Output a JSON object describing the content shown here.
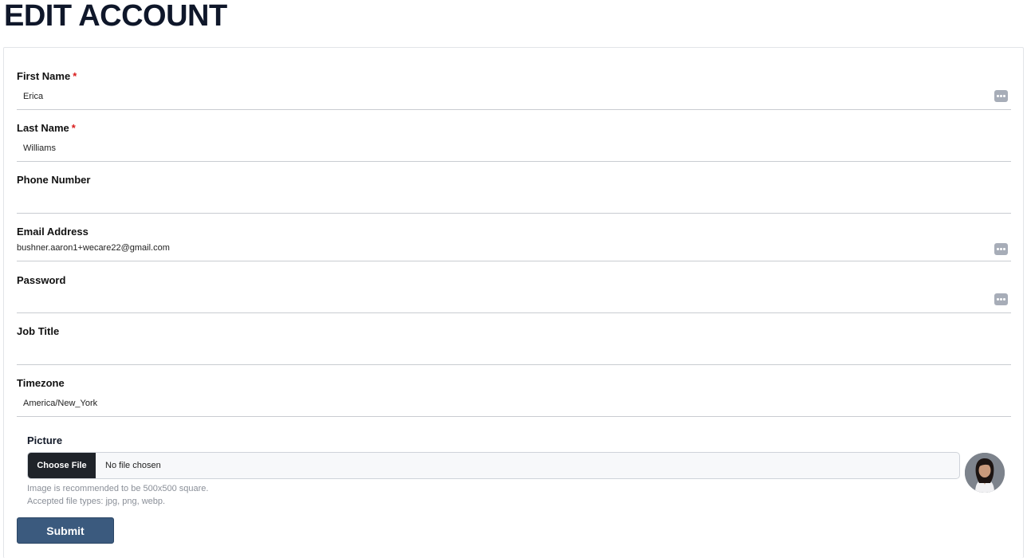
{
  "page": {
    "title": "EDIT ACCOUNT"
  },
  "form": {
    "first_name": {
      "label": "First Name",
      "required": "*",
      "value": "Erica"
    },
    "last_name": {
      "label": "Last Name",
      "required": "*",
      "value": "Williams"
    },
    "phone": {
      "label": "Phone Number",
      "value": ""
    },
    "email": {
      "label": "Email Address",
      "value": "bushner.aaron1+wecare22@gmail.com"
    },
    "password": {
      "label": "Password",
      "value": ""
    },
    "job_title": {
      "label": "Job Title",
      "value": ""
    },
    "timezone": {
      "label": "Timezone",
      "value": "America/New_York"
    },
    "picture": {
      "label": "Picture",
      "choose_file_label": "Choose File",
      "file_status": "No file chosen",
      "hint_size": "Image is recommended to be 500x500 square.",
      "hint_types": "Accepted file types: jpg, png, webp."
    },
    "submit_label": "Submit"
  },
  "icons": {
    "password_manager": "password-manager-icon",
    "avatar": "avatar"
  },
  "colors": {
    "submit_button": "#3b5a7e",
    "required": "#d91c1c",
    "choose_file_button": "#1f2329"
  }
}
